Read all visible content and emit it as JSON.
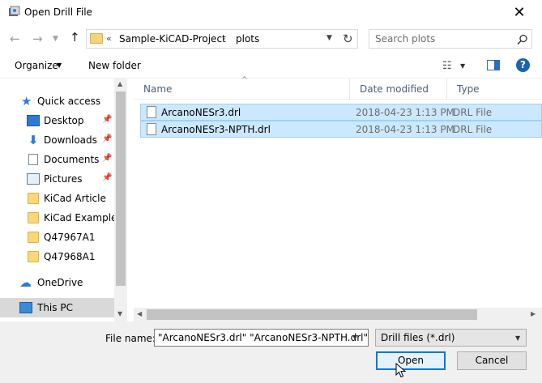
{
  "window": {
    "title": "Open Drill File"
  },
  "address": {
    "chevron": "«",
    "segment1": "Sample-KiCAD-Project",
    "separator": "›",
    "segment2": "plots"
  },
  "search": {
    "placeholder": "Search plots"
  },
  "toolbar": {
    "organize": "Organize",
    "new_folder": "New folder"
  },
  "sidebar": {
    "items": [
      {
        "label": "Quick access",
        "icon": "star-icon"
      },
      {
        "label": "Desktop",
        "icon": "desktop-icon",
        "pinned": true
      },
      {
        "label": "Downloads",
        "icon": "download-icon",
        "pinned": true
      },
      {
        "label": "Documents",
        "icon": "documents-icon",
        "pinned": true
      },
      {
        "label": "Pictures",
        "icon": "pictures-icon",
        "pinned": true
      },
      {
        "label": "KiCad Article",
        "icon": "folder-icon"
      },
      {
        "label": "KiCad Example",
        "icon": "folder-icon"
      },
      {
        "label": "Q47967A1",
        "icon": "folder-icon"
      },
      {
        "label": "Q47968A1",
        "icon": "folder-icon"
      },
      {
        "label": "OneDrive",
        "icon": "cloud-icon"
      },
      {
        "label": "This PC",
        "icon": "computer-icon"
      }
    ]
  },
  "columns": {
    "name": "Name",
    "date": "Date modified",
    "type": "Type"
  },
  "files": [
    {
      "name": "ArcanoNESr3.drl",
      "date": "2018-04-23 1:13 PM",
      "type": "DRL File"
    },
    {
      "name": "ArcanoNESr3-NPTH.drl",
      "date": "2018-04-23 1:13 PM",
      "type": "DRL File"
    }
  ],
  "bottom": {
    "filename_label": "File name:",
    "filename_value": "\"ArcanoNESr3.drl\" \"ArcanoNESr3-NPTH.drl\"",
    "filetype_value": "Drill files (*.drl)",
    "open_label": "Open",
    "cancel_label": "Cancel"
  },
  "colors": {
    "selection": "#cce8ff",
    "accent": "#0078d7"
  }
}
